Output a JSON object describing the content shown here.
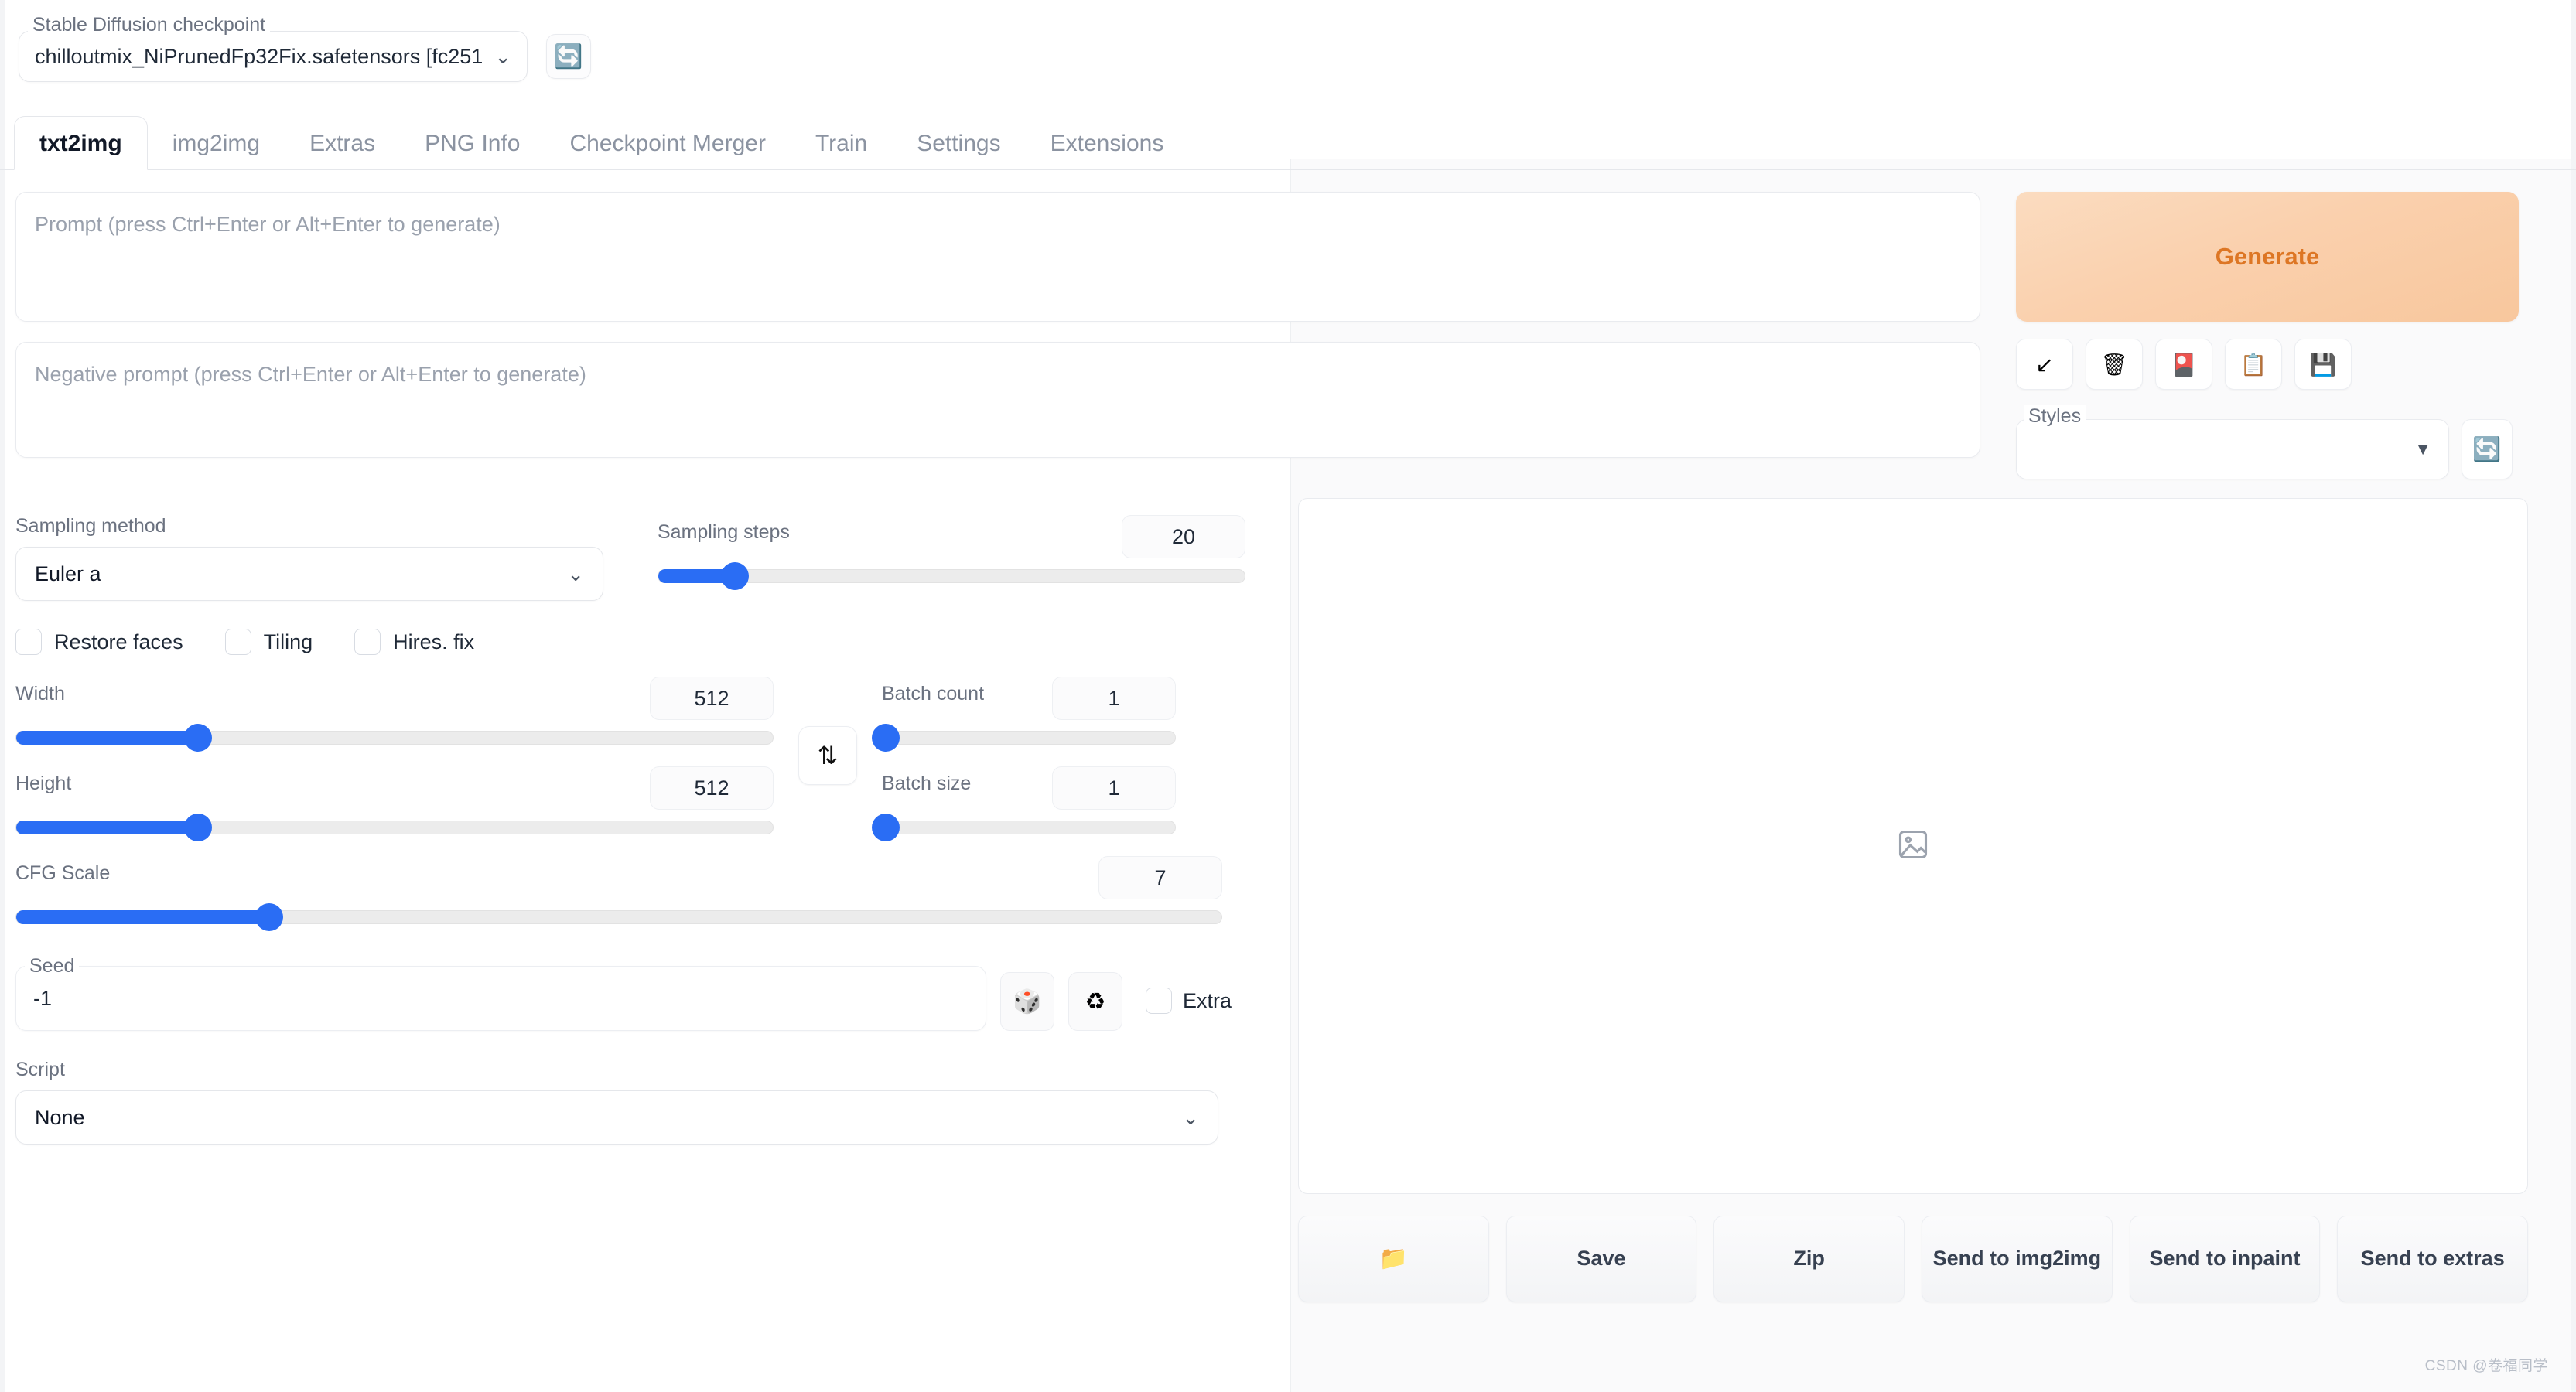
{
  "checkpoint": {
    "label": "Stable Diffusion checkpoint",
    "value": "chilloutmix_NiPrunedFp32Fix.safetensors [fc251",
    "chevron": "⌄",
    "refresh_icon": "🔄"
  },
  "tabs": [
    {
      "label": "txt2img",
      "active": true
    },
    {
      "label": "img2img",
      "active": false
    },
    {
      "label": "Extras",
      "active": false
    },
    {
      "label": "PNG Info",
      "active": false
    },
    {
      "label": "Checkpoint Merger",
      "active": false
    },
    {
      "label": "Train",
      "active": false
    },
    {
      "label": "Settings",
      "active": false
    },
    {
      "label": "Extensions",
      "active": false
    }
  ],
  "prompt": {
    "placeholder": "Prompt (press Ctrl+Enter or Alt+Enter to generate)",
    "value": ""
  },
  "negative_prompt": {
    "placeholder": "Negative prompt (press Ctrl+Enter or Alt+Enter to generate)",
    "value": ""
  },
  "generate": {
    "label": "Generate",
    "accent": "#dd7624"
  },
  "tool_buttons": [
    {
      "name": "restore-progress",
      "icon": "↙"
    },
    {
      "name": "clear-prompt",
      "icon": "🗑"
    },
    {
      "name": "show-extra-networks",
      "icon": "🎴"
    },
    {
      "name": "apply-style",
      "icon": "📋"
    },
    {
      "name": "save-style",
      "icon": "💾"
    }
  ],
  "styles": {
    "label": "Styles",
    "value": "",
    "chevron": "▼",
    "refresh_icon": "🔄"
  },
  "sampling_method": {
    "label": "Sampling method",
    "value": "Euler a",
    "chevron": "⌄"
  },
  "sampling_steps": {
    "label": "Sampling steps",
    "value": "20",
    "min": 1,
    "max": 150,
    "percent": 13
  },
  "checkboxes": [
    {
      "label": "Restore faces",
      "checked": false
    },
    {
      "label": "Tiling",
      "checked": false
    },
    {
      "label": "Hires. fix",
      "checked": false
    }
  ],
  "width": {
    "label": "Width",
    "value": "512",
    "min": 64,
    "max": 2048,
    "percent": 24
  },
  "height": {
    "label": "Height",
    "value": "512",
    "min": 64,
    "max": 2048,
    "percent": 24
  },
  "cfg_scale": {
    "label": "CFG Scale",
    "value": "7",
    "min": 1,
    "max": 30,
    "percent": 21
  },
  "swap_button": {
    "icon": "⇅",
    "name": "swap-width-height"
  },
  "batch_count": {
    "label": "Batch count",
    "value": "1",
    "min": 1,
    "max": 100,
    "percent": 1
  },
  "batch_size": {
    "label": "Batch size",
    "value": "1",
    "min": 1,
    "max": 8,
    "percent": 1
  },
  "seed": {
    "label": "Seed",
    "value": "-1",
    "random_icon": "🎲",
    "reuse_icon": "♻",
    "extra_label": "Extra",
    "extra_checked": false
  },
  "script": {
    "label": "Script",
    "value": "None",
    "chevron": "⌄"
  },
  "gallery": {
    "placeholder_icon": "image-placeholder"
  },
  "result_buttons": [
    {
      "label": "📁",
      "name": "open-folder",
      "icon_only": true
    },
    {
      "label": "Save",
      "name": "save",
      "icon_only": false
    },
    {
      "label": "Zip",
      "name": "zip",
      "icon_only": false
    },
    {
      "label": "Send to img2img",
      "name": "send-to-img2img",
      "icon_only": false
    },
    {
      "label": "Send to inpaint",
      "name": "send-to-inpaint",
      "icon_only": false
    },
    {
      "label": "Send to extras",
      "name": "send-to-extras",
      "icon_only": false
    }
  ],
  "watermark": "CSDN @卷福同学"
}
